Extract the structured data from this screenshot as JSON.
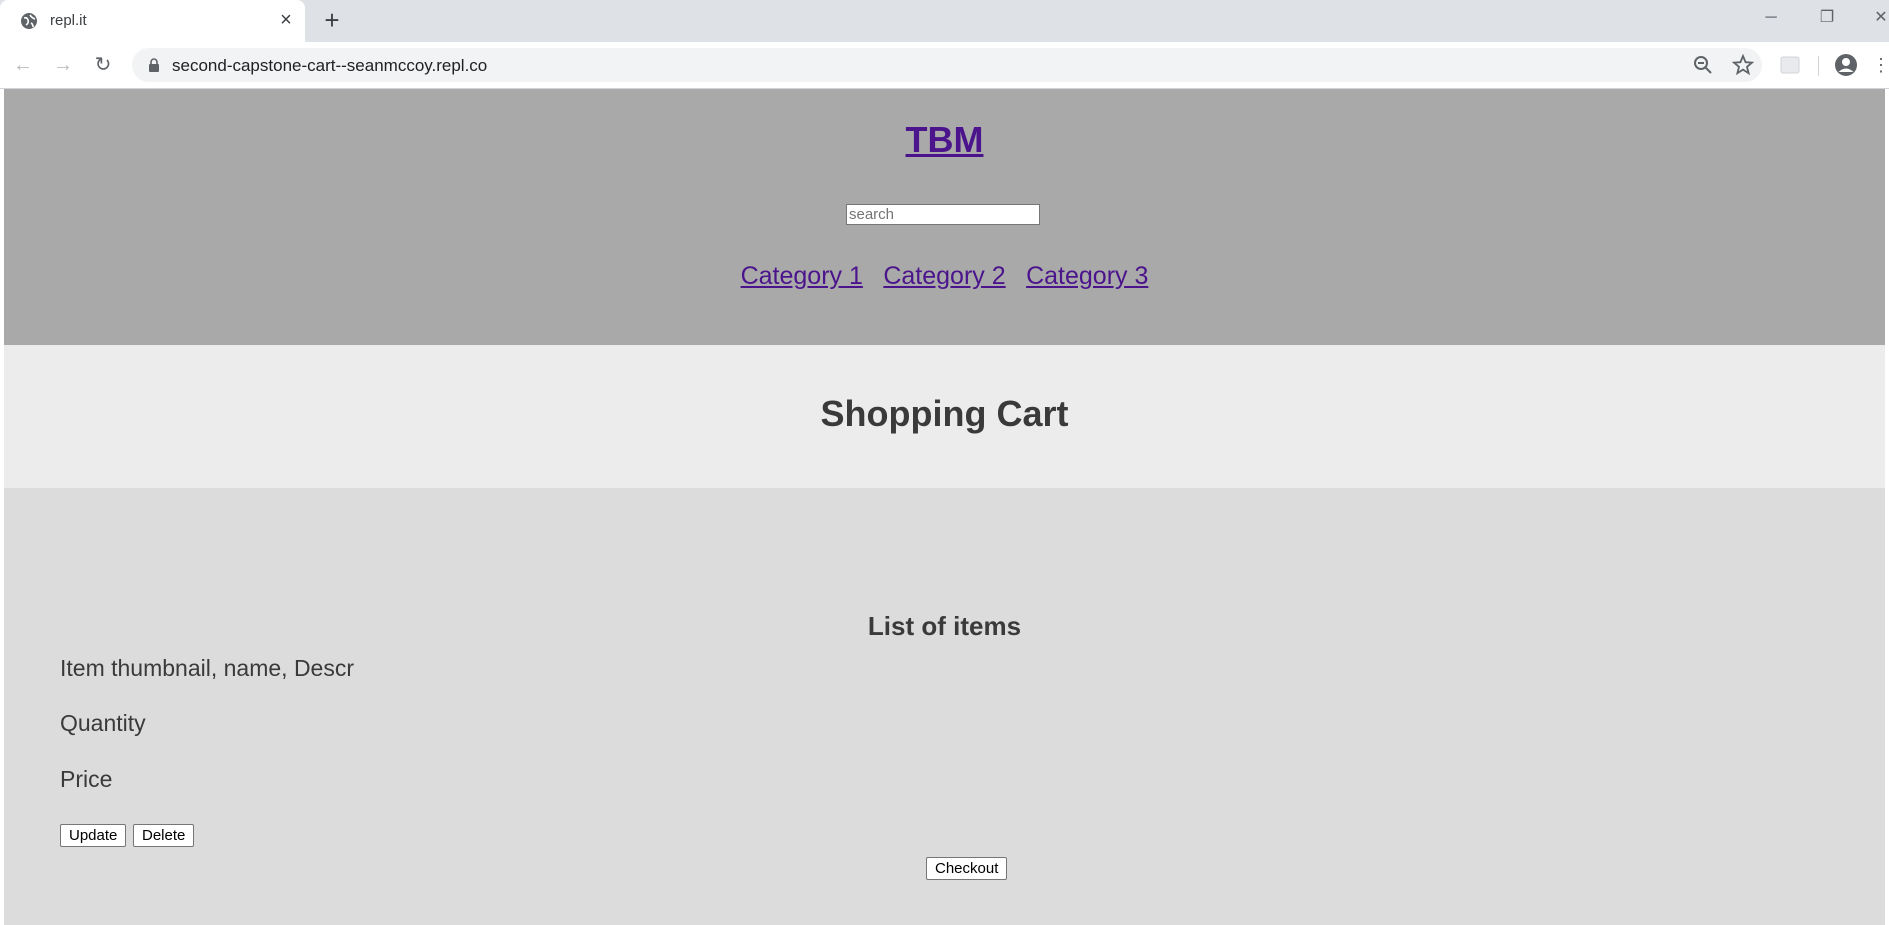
{
  "browser": {
    "tab_title": "repl.it",
    "url": "second-capstone-cart--seanmccoy.repl.co"
  },
  "header": {
    "brand": "TBM",
    "search_placeholder": "search",
    "categories": [
      "Category 1",
      "Category 2",
      "Category 3"
    ]
  },
  "title_section": {
    "title": "Shopping Cart"
  },
  "cart": {
    "heading": "List of items",
    "item_info": "Item thumbnail, name, Descr",
    "quantity_label": "Quantity",
    "price_label": "Price",
    "update_label": "Update",
    "delete_label": "Delete",
    "checkout_label": "Checkout"
  },
  "colors": {
    "header_bg": "#a9a9a9",
    "title_bg": "#ececec",
    "cart_bg": "#dcdcdc",
    "link": "#4b148c"
  }
}
